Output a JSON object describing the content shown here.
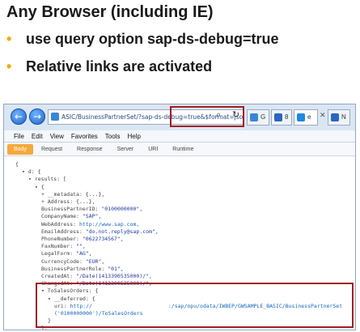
{
  "slide": {
    "title": "Any Browser (including IE)",
    "bullets": [
      "use query option sap-ds-debug=true",
      "Relative links are activated"
    ]
  },
  "browser": {
    "url": "ASIC/BusinessPartnerSet/?sap-ds-debug=true&$format=json",
    "tabs": [
      {
        "label": "G",
        "icon_color": "#3a86d8"
      },
      {
        "label": "8",
        "icon_color": "#2b66c1"
      },
      {
        "label": "e",
        "icon_color": "#1e88e5"
      },
      {
        "label": "N",
        "icon_color": "#2b66c1"
      }
    ],
    "menu": [
      "File",
      "Edit",
      "View",
      "Favorites",
      "Tools",
      "Help"
    ],
    "toolbar_tabs": [
      "Body",
      "Request",
      "Response",
      "Server",
      "URI",
      "Runtime"
    ],
    "active_toolbar_tab": "Body"
  },
  "json_view": {
    "lines": [
      {
        "indent": 0,
        "text": "{"
      },
      {
        "indent": 1,
        "tri": "▾",
        "key": "d",
        "text": ": {"
      },
      {
        "indent": 2,
        "tri": "▾",
        "key": "results",
        "text": ": ["
      },
      {
        "indent": 3,
        "tri": "▾",
        "text": "{"
      },
      {
        "indent": 4,
        "tri": "+",
        "key": "__metadata",
        "text": ": {...},"
      },
      {
        "indent": 4,
        "tri": "+",
        "key": "Address",
        "text": ": {...},"
      },
      {
        "indent": 4,
        "key": "BusinessPartnerID",
        "str": "\"0100000000\","
      },
      {
        "indent": 4,
        "key": "CompanyName",
        "str": "\"SAP\","
      },
      {
        "indent": 4,
        "key": "WebAddress",
        "lnk": "http://www.sap.com,"
      },
      {
        "indent": 4,
        "key": "EmailAddress",
        "str": "\"do.not.reply@sap.com\","
      },
      {
        "indent": 4,
        "key": "PhoneNumber",
        "str": "\"0622734567\","
      },
      {
        "indent": 4,
        "key": "FaxNumber",
        "str": "\"\","
      },
      {
        "indent": 4,
        "key": "LegalForm",
        "str": "\"AG\","
      },
      {
        "indent": 4,
        "key": "CurrencyCode",
        "str": "\"EUR\","
      },
      {
        "indent": 4,
        "key": "BusinessPartnerRole",
        "str": "\"01\","
      },
      {
        "indent": 4,
        "key": "CreatedAt",
        "str": "\"/Date(1413390535000)/\","
      },
      {
        "indent": 4,
        "key": "ChangedAt",
        "str": "\"/Date(1413390535000)/\","
      },
      {
        "indent": 4,
        "tri": "▾",
        "key": "ToSalesOrders",
        "text": ": {"
      },
      {
        "indent": 5,
        "tri": "▾",
        "key": "__deferred",
        "text": ": {"
      },
      {
        "indent": 6,
        "key": "uri",
        "lnk": "http://                        :/sap/opu/odata/IWBEP/GWSAMPLE_BASIC/BusinessPartnerSet"
      },
      {
        "indent": 6,
        "lnk": "('0100000000')/ToSalesOrders"
      },
      {
        "indent": 5,
        "text": "}"
      },
      {
        "indent": 4,
        "text": "},"
      }
    ]
  }
}
